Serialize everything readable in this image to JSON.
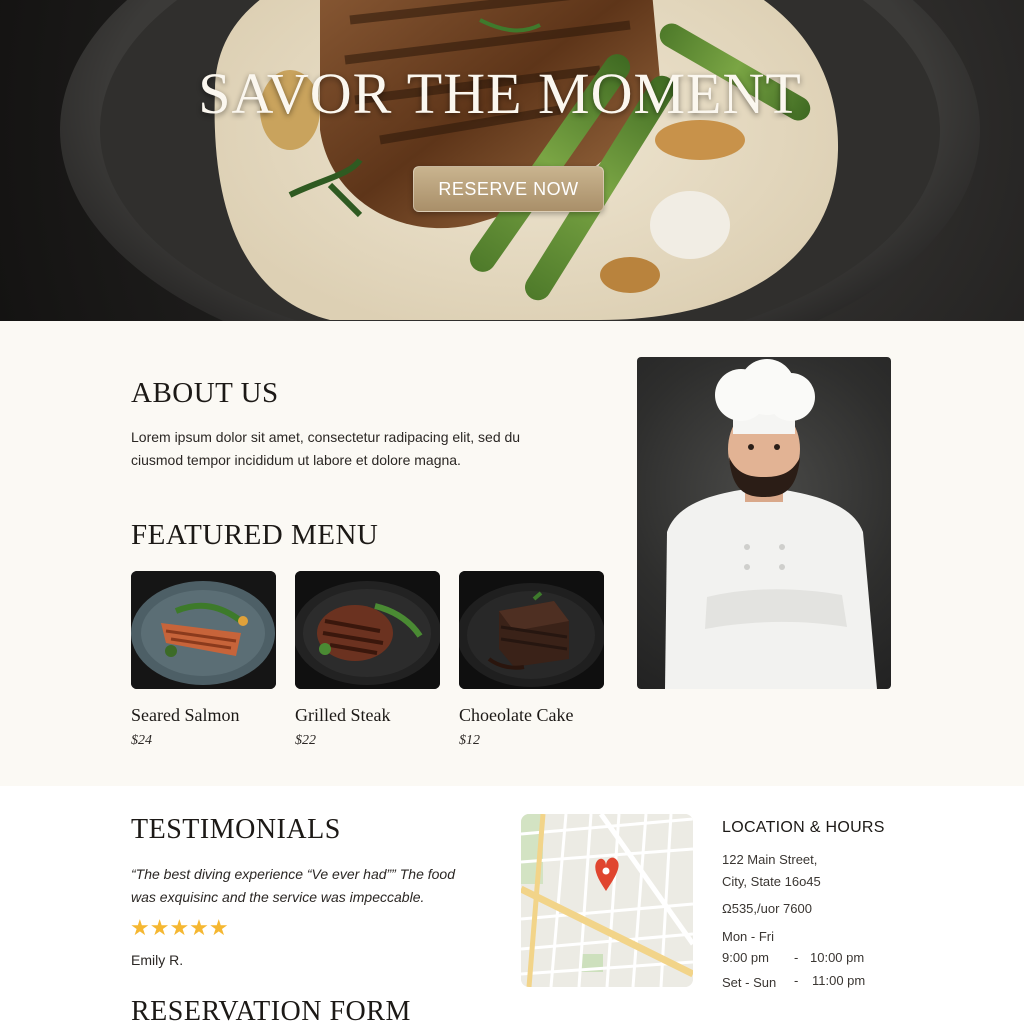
{
  "hero": {
    "title": "SAVOR THE MOMENT",
    "cta_label": "RESERVE NOW"
  },
  "about": {
    "heading": "ABOUT US",
    "body": "Lorem ipsum dolor sit amet, consectetur radipacing elit, sed du ciusmod tempor incididum ut labore et dolore magna."
  },
  "menu": {
    "heading": "FEATURED MENU",
    "items": [
      {
        "name": "Seared Salmon",
        "price": "$24"
      },
      {
        "name": "Grilled Steak",
        "price": "$22"
      },
      {
        "name": "Choeolate Cake",
        "price": "$12"
      }
    ]
  },
  "testimonials": {
    "heading": "TESTIMONIALS",
    "quote": "“The best diving experience “Ve ever had”” The food was exquisinc and the service was impeccable.",
    "stars": "★★★★★",
    "rating": 5,
    "author": "Emily R."
  },
  "reservation": {
    "heading": "RESERVATION FORM"
  },
  "location": {
    "heading": "LOCATION & HOURS",
    "address_line1": "122 Main Street,",
    "address_line2": "City, State 16o45",
    "phone": "Ω535,/uor 7600",
    "weekday_days": "Mon - Fri",
    "weekday_open": "9:00 pm",
    "weekday_dash": "-",
    "weekday_close": "10:00 pm",
    "weekend_days": "Set - Sun",
    "weekend_dash": "-",
    "weekend_close": "11:00 pm"
  },
  "colors": {
    "accent_gold": "#b49b74",
    "star": "#f5b731",
    "map_pin": "#e0452f",
    "section_bg": "#fbf9f4"
  },
  "icons": [
    "map-pin-icon",
    "star-icon"
  ]
}
